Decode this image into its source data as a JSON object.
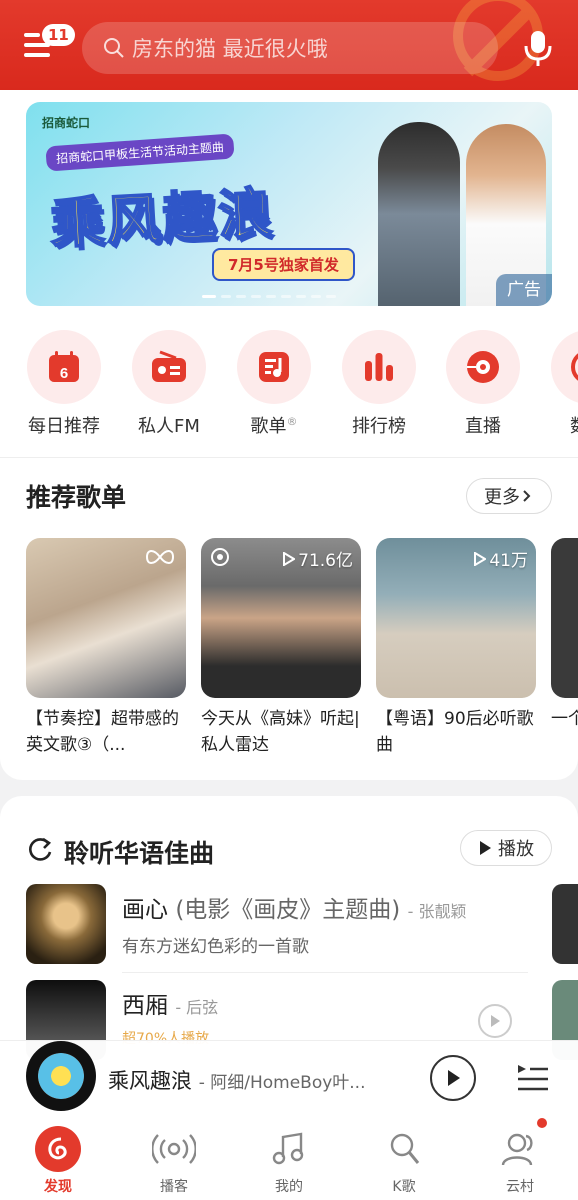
{
  "header": {
    "notification_count": "11",
    "search_placeholder": "房东的猫 最近很火哦"
  },
  "banner": {
    "brand": "招商蛇口",
    "subtitle": "招商蛇口甲板生活节活动主题曲",
    "title": "乘风趣浪",
    "release": "7月5号独家首发",
    "ad_label": "广告"
  },
  "shortcuts": [
    {
      "label": "每日推荐",
      "icon": "calendar-icon",
      "day": "6"
    },
    {
      "label": "私人FM",
      "icon": "radio-icon"
    },
    {
      "label": "歌单",
      "icon": "playlist-icon",
      "mark": "®"
    },
    {
      "label": "排行榜",
      "icon": "chart-icon"
    },
    {
      "label": "直播",
      "icon": "live-icon"
    },
    {
      "label": "数字",
      "icon": "digital-icon"
    }
  ],
  "recommended": {
    "title": "推荐歌单",
    "more": "更多",
    "playlists": [
      {
        "name": "【节奏控】超带感的英文歌③（...",
        "count": ""
      },
      {
        "name": "今天从《高妹》听起|私人雷达",
        "count": "71.6亿"
      },
      {
        "name": "【粤语】90后必听歌曲",
        "count": "41万"
      },
      {
        "name": "一个单曲",
        "count": ""
      }
    ]
  },
  "chinese_songs": {
    "title": "聆听华语佳曲",
    "play": "播放",
    "songs": [
      {
        "title": "画心",
        "paren": "(电影《画皮》主题曲)",
        "artist": "- 张靓颖",
        "desc": "有东方迷幻色彩的一首歌"
      },
      {
        "title": "西厢",
        "artist": "- 后弦",
        "desc": "超70%人播放"
      }
    ]
  },
  "mini_player": {
    "title": "乘风趣浪",
    "artist": "- 阿细/HomeBoy叶..."
  },
  "tabs": [
    {
      "label": "发现",
      "icon": "discover-icon",
      "active": true
    },
    {
      "label": "播客",
      "icon": "podcast-icon"
    },
    {
      "label": "我的",
      "icon": "music-note-icon"
    },
    {
      "label": "K歌",
      "icon": "karaoke-icon"
    },
    {
      "label": "云村",
      "icon": "community-icon"
    }
  ],
  "colors": {
    "brand_red": "#e33a2c",
    "light_red": "#fdebeb"
  }
}
